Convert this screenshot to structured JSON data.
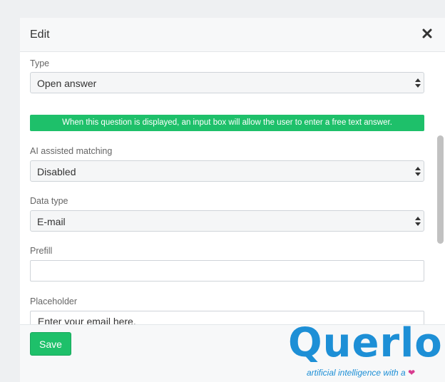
{
  "header": {
    "title": "Edit"
  },
  "fields": {
    "type": {
      "label": "Type",
      "value": "Open answer"
    },
    "type_help": "When this question is displayed, an input box will allow the user to enter a free text answer.",
    "ai_matching": {
      "label": "AI assisted matching",
      "value": "Disabled"
    },
    "data_type": {
      "label": "Data type",
      "value": "E-mail"
    },
    "prefill": {
      "label": "Prefill",
      "value": ""
    },
    "placeholder": {
      "label": "Placeholder",
      "value": "Enter your email here."
    }
  },
  "footer": {
    "save_label": "Save"
  },
  "brand": {
    "name": "Querlo",
    "tagline": "artificial intelligence with a",
    "color": "#1d8fd6",
    "accent": "#1ec06a"
  },
  "icons": {
    "close": "close-icon",
    "select_arrows": "select-arrows-icon",
    "heart": "heart-icon"
  }
}
